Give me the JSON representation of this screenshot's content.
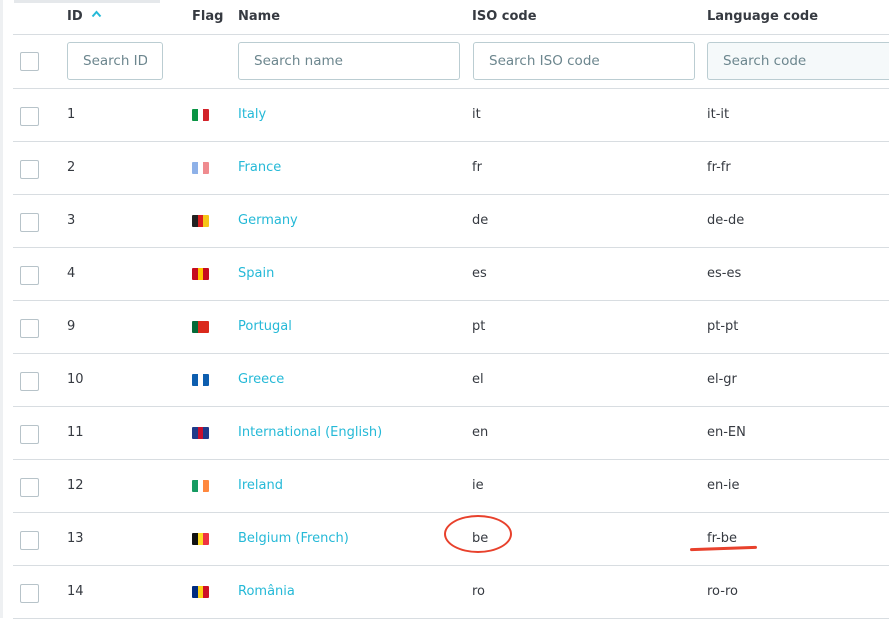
{
  "table": {
    "headers": {
      "id": "ID",
      "flag": "Flag",
      "name": "Name",
      "iso": "ISO code",
      "lang": "Language code"
    },
    "filters": {
      "id": "Search ID",
      "name": "Search name",
      "iso": "Search ISO code",
      "lang": "Search code"
    },
    "rows": [
      {
        "id": "1",
        "name": "Italy",
        "iso": "it",
        "lang": "it-it",
        "flag": [
          "#0a9444",
          "#ffffff",
          "#d2232a"
        ]
      },
      {
        "id": "2",
        "name": "France",
        "iso": "fr",
        "lang": "fr-fr",
        "flag": [
          "#8eb1e8",
          "#ffffff",
          "#ef8b8f"
        ]
      },
      {
        "id": "3",
        "name": "Germany",
        "iso": "de",
        "lang": "de-de",
        "flag": [
          "#222222",
          "#dd1f1f",
          "#f5c518"
        ]
      },
      {
        "id": "4",
        "name": "Spain",
        "iso": "es",
        "lang": "es-es",
        "flag": [
          "#c60b1e",
          "#ffc400",
          "#c60b1e"
        ]
      },
      {
        "id": "9",
        "name": "Portugal",
        "iso": "pt",
        "lang": "pt-pt",
        "flag": [
          "#046a38",
          "#da291c",
          "#da291c"
        ]
      },
      {
        "id": "10",
        "name": "Greece",
        "iso": "el",
        "lang": "el-gr",
        "flag": [
          "#0d5eaf",
          "#ffffff",
          "#0d5eaf"
        ]
      },
      {
        "id": "11",
        "name": "International (English)",
        "iso": "en",
        "lang": "en-EN",
        "flag": [
          "#1f3a8a",
          "#c8102e",
          "#1f3a8a"
        ]
      },
      {
        "id": "12",
        "name": "Ireland",
        "iso": "ie",
        "lang": "en-ie",
        "flag": [
          "#169b62",
          "#ffffff",
          "#ff883e"
        ]
      },
      {
        "id": "13",
        "name": "Belgium (French)",
        "iso": "be",
        "lang": "fr-be",
        "flag": [
          "#111111",
          "#fdda24",
          "#ef3340"
        ]
      },
      {
        "id": "14",
        "name": "România",
        "iso": "ro",
        "lang": "ro-ro",
        "flag": [
          "#002b7f",
          "#fcd116",
          "#ce1126"
        ]
      }
    ]
  },
  "colors": {
    "link": "#25b9d7",
    "annotation": "#e8412c",
    "text": "#363a41"
  },
  "icons": {
    "sort": "sort-ascending-icon"
  }
}
